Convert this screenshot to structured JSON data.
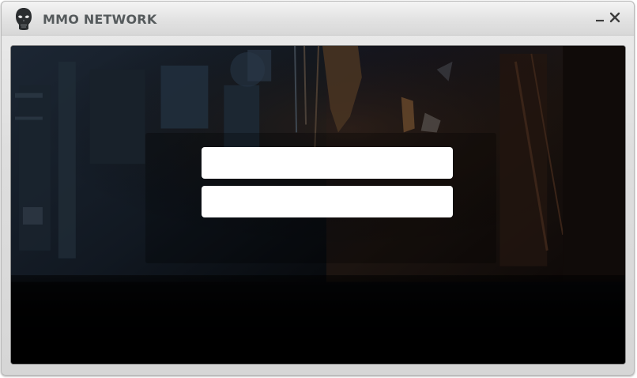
{
  "window": {
    "title": "MMO NETWORK",
    "logo_icon": "skull-mask-icon",
    "minimize_icon": "minimize-icon",
    "close_icon": "close-icon"
  },
  "login": {
    "username_value": "",
    "username_placeholder": "",
    "password_value": "",
    "password_placeholder": ""
  },
  "colors": {
    "title_text": "#555a5c",
    "titlebar": "#e2e2e2",
    "background": "#05060a",
    "field_background": "#ffffff"
  }
}
